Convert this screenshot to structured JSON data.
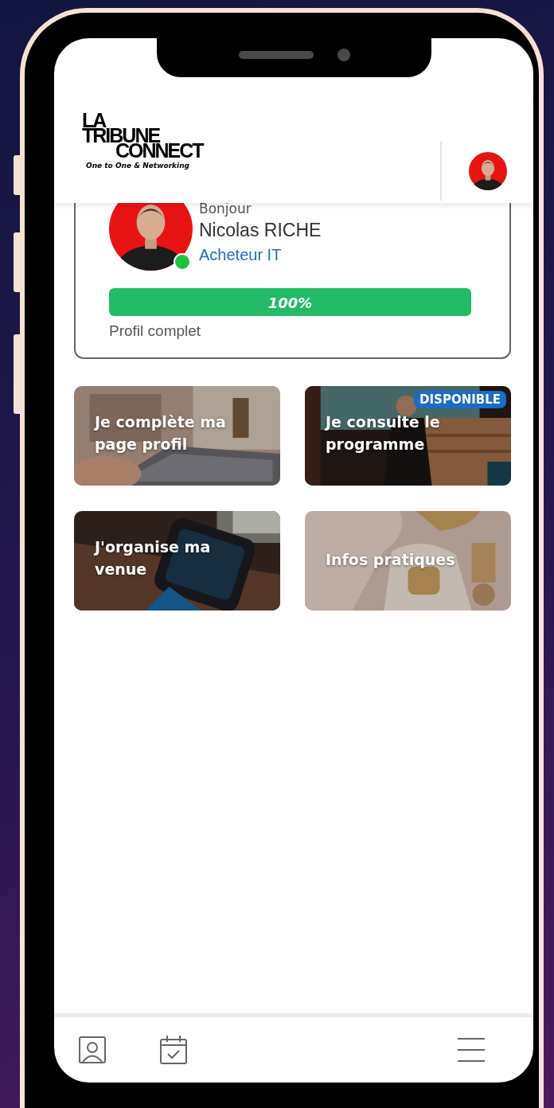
{
  "header": {
    "logo": {
      "line_1": "LA",
      "line_2": "TRIBUNE",
      "line_3": "CONNECT",
      "tagline": "One to One & Networking"
    }
  },
  "profile": {
    "greeting": "Bonjour",
    "name": "Nicolas RICHE",
    "role": "Acheteur IT",
    "online": true,
    "progress": {
      "level": 1,
      "reading": "100%"
    },
    "status": "Profil complet"
  },
  "tiles": [
    {
      "title": "Je complète ma page profil"
    },
    {
      "title": "Je consulte le programme",
      "badge": "DISPONIBLE"
    },
    {
      "title": "J'organise ma venue"
    },
    {
      "title": "Infos pratiques"
    }
  ]
}
